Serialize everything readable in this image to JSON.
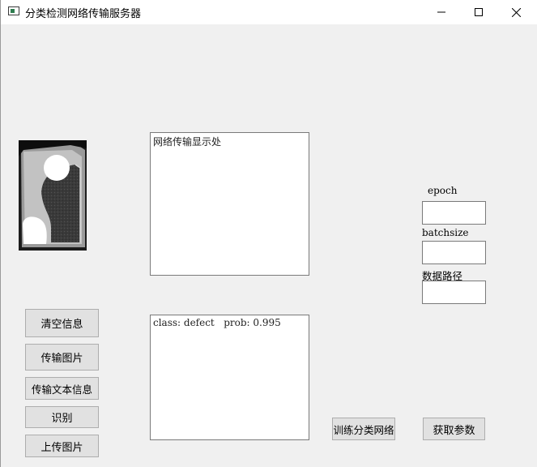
{
  "window": {
    "title": "分类检测网络传输服务器",
    "controls": {
      "minimize": "—",
      "maximize": "☐",
      "close": "✕"
    }
  },
  "panels": {
    "network_display": {
      "text": "网络传输显示处"
    },
    "result_display": {
      "text": "class: defect   prob: 0.995"
    }
  },
  "buttons": {
    "clear_info": "清空信息",
    "send_image": "传输图片",
    "send_text": "传输文本信息",
    "recognize": "识别",
    "upload_image": "上传图片",
    "train_network": "训练分类网络",
    "get_params": "获取参数"
  },
  "params": {
    "epoch_label": "epoch",
    "epoch_value": "",
    "batchsize_label": "batchsize",
    "batchsize_value": "",
    "data_path_label": "数据路径",
    "data_path_value": ""
  },
  "icons": {
    "app": "app-window-icon",
    "preview": "defect-sample-image"
  },
  "colors": {
    "window_bg": "#f0f0f0",
    "titlebar_bg": "#ffffff",
    "button_bg": "#e1e1e1",
    "button_border": "#adadad"
  }
}
